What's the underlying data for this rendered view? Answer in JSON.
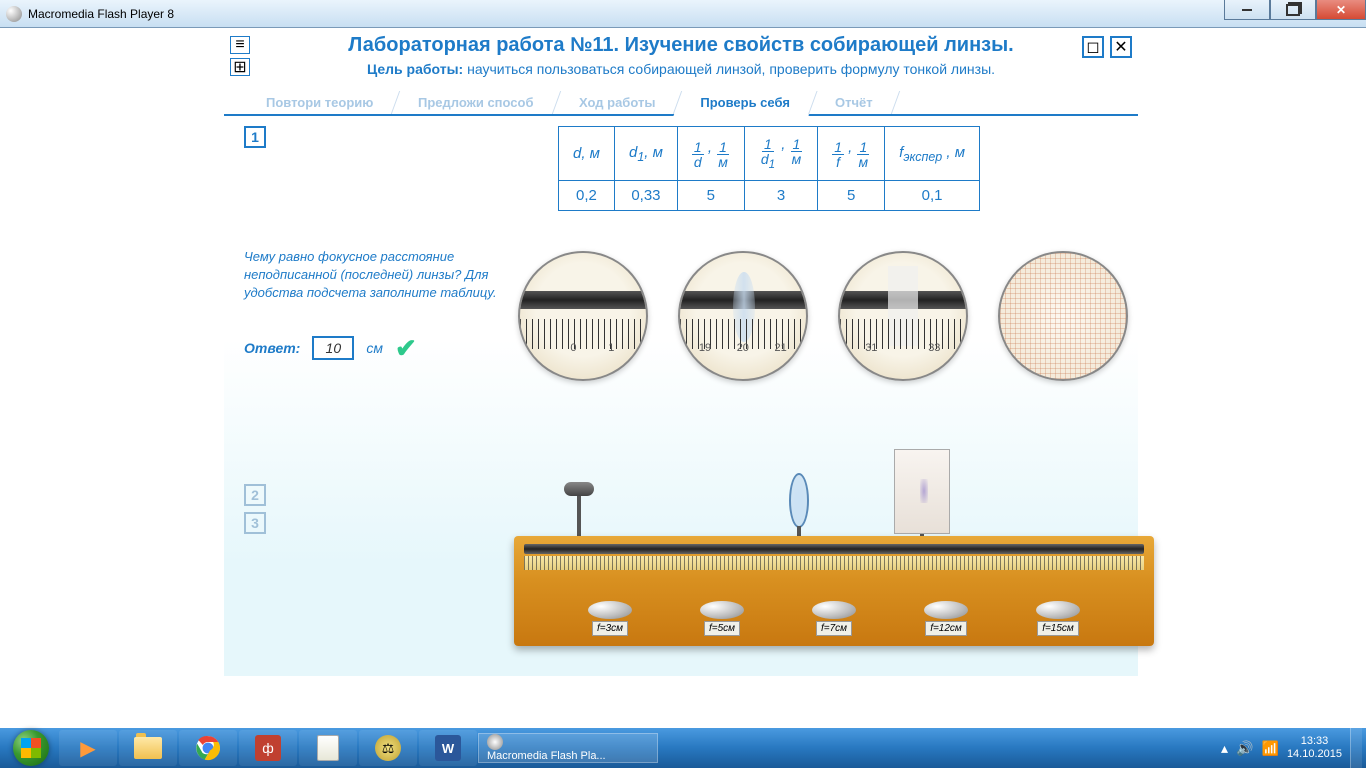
{
  "window": {
    "title": "Macromedia Flash Player 8"
  },
  "header": {
    "title": "Лабораторная работа №11.  Изучение свойств собирающей линзы.",
    "goal_label": "Цель работы:",
    "goal_text": " научиться пользоваться собирающей линзой, проверить формулу тонкой линзы."
  },
  "tabs": [
    {
      "label": "Повтори теорию",
      "active": false
    },
    {
      "label": "Предложи способ",
      "active": false
    },
    {
      "label": "Ход работы",
      "active": false
    },
    {
      "label": "Проверь себя",
      "active": true
    },
    {
      "label": "Отчёт",
      "active": false
    }
  ],
  "questions": {
    "nums": [
      "1",
      "2",
      "3"
    ],
    "text": "Чему равно фокусное расстояние неподписанной (последней) линзы? Для удобства подсчета заполните таблицу.",
    "answer_label": "Ответ:",
    "answer_value": "10",
    "answer_unit": "см"
  },
  "table": {
    "headers": [
      "d, м",
      "d₁, м",
      "1/d , 1/м",
      "1/d₁ , 1/м",
      "1/f , 1/м",
      "fэкспер , м"
    ],
    "row": [
      "0,2",
      "0,33",
      "5",
      "3",
      "5",
      "0,1"
    ]
  },
  "magnifiers": {
    "labels": [
      [
        "0",
        "1"
      ],
      [
        "19",
        "20",
        "21"
      ],
      [
        "31",
        "33"
      ]
    ]
  },
  "lens_buttons": [
    "f=3см",
    "f=5см",
    "f=7см",
    "f=12см",
    "f=15см"
  ],
  "taskbar": {
    "running": "Macromedia Flash Pla...",
    "time": "13:33",
    "date": "14.10.2015"
  }
}
